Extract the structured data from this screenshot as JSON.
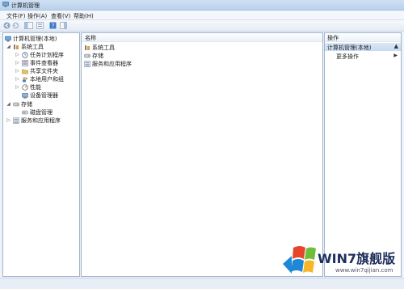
{
  "window": {
    "title": "计算机管理"
  },
  "menu": {
    "file": "文件(F)",
    "action": "操作(A)",
    "view": "查看(V)",
    "help": "帮助(H)"
  },
  "tree": {
    "root": "计算机管理(本地)",
    "system_tools": "系统工具",
    "task_scheduler": "任务计划程序",
    "event_viewer": "事件查看器",
    "shared_folders": "共享文件夹",
    "local_users": "本地用户和组",
    "performance": "性能",
    "device_manager": "设备管理器",
    "storage": "存储",
    "disk_management": "磁盘管理",
    "services_apps": "服务和应用程序"
  },
  "center": {
    "column_name": "名称",
    "items": [
      "系统工具",
      "存储",
      "服务和应用程序"
    ]
  },
  "actions": {
    "header": "操作",
    "group": "计算机管理(本地)",
    "more": "更多操作"
  },
  "watermark": {
    "brand": "WIN7旗舰版",
    "url": "www.win7qijian.com"
  },
  "colors": {
    "accent": "#c7dbf1",
    "border": "#9fb4cc"
  }
}
